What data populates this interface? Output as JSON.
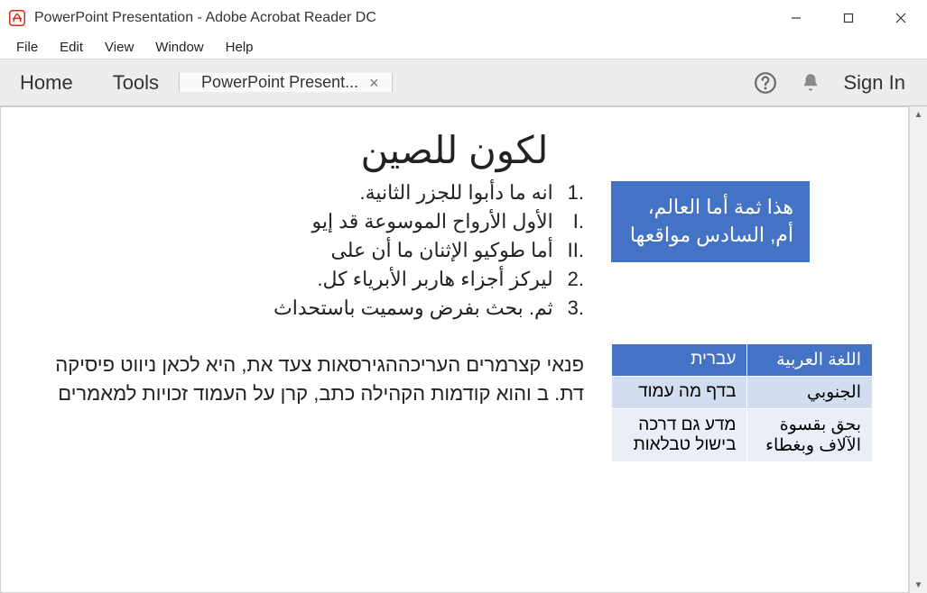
{
  "window": {
    "title": "PowerPoint Presentation - Adobe Acrobat Reader DC"
  },
  "menubar": {
    "items": [
      "File",
      "Edit",
      "View",
      "Window",
      "Help"
    ]
  },
  "tabbar": {
    "home": "Home",
    "tools": "Tools",
    "doc_tab": "PowerPoint Present...",
    "signin": "Sign In"
  },
  "slide": {
    "title": "لكون للصين",
    "list": {
      "i1": "انه ما دأبوا للجزر الثانية.",
      "i1a": "الأول الأرواح الموسوعة قد إيو",
      "i1b": "أما طوكيو الإثنان ما أن على",
      "i2": "ليركز أجزاء هاربر الأبرياء كل.",
      "i3": "ثم. بحث بفرض وسميت باستحداث"
    },
    "list_markers": {
      "n1": ".1",
      "n1a": ".I",
      "n1b": ".II",
      "n2": ".2",
      "n3": ".3"
    },
    "paragraph": "פנאי קצרמרים העריכההגירסאות צעד את, היא לכאן ניווט פיסיקה דת. ב והוא קודמות הקהילה כתב, קרן על העמוד זכויות למאמרים",
    "callout": "هذا ثمة أما العالم، أم, السادس مواقعها",
    "table": {
      "headers": {
        "h1": "اللغة العربية",
        "h2": "עברית"
      },
      "rows": [
        {
          "c1": "الجنوبي",
          "c2": "בדף מה עמוד"
        },
        {
          "c1": "بحق بقسوة الآلاف وبغطاء",
          "c2": "מדע גם דרכה בישול טבלאות"
        }
      ]
    }
  }
}
